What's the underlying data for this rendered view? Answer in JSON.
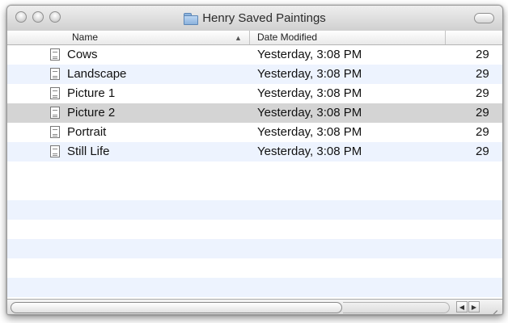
{
  "window": {
    "title": "Henry Saved Paintings",
    "folder_icon": "folder-icon"
  },
  "columns": {
    "name": "Name",
    "date": "Date Modified",
    "size": "",
    "sort_indicator": "▲"
  },
  "files": [
    {
      "name": "Cows",
      "date": "Yesterday, 3:08 PM",
      "size": "29",
      "icon": "document-icon"
    },
    {
      "name": "Landscape",
      "date": "Yesterday, 3:08 PM",
      "size": "29",
      "icon": "document-icon"
    },
    {
      "name": "Picture 1",
      "date": "Yesterday, 3:08 PM",
      "size": "29",
      "icon": "document-icon"
    },
    {
      "name": "Picture 2",
      "date": "Yesterday, 3:08 PM",
      "size": "29",
      "icon": "document-icon",
      "selected": true
    },
    {
      "name": "Portrait",
      "date": "Yesterday, 3:08 PM",
      "size": "29",
      "icon": "document-icon"
    },
    {
      "name": "Still Life",
      "date": "Yesterday, 3:08 PM",
      "size": "29",
      "icon": "document-icon"
    }
  ],
  "scrollbar": {
    "left_arrow": "◀",
    "right_arrow": "▶"
  },
  "colors": {
    "stripe": "#edf3fe",
    "selected": "#d4d4d4"
  }
}
